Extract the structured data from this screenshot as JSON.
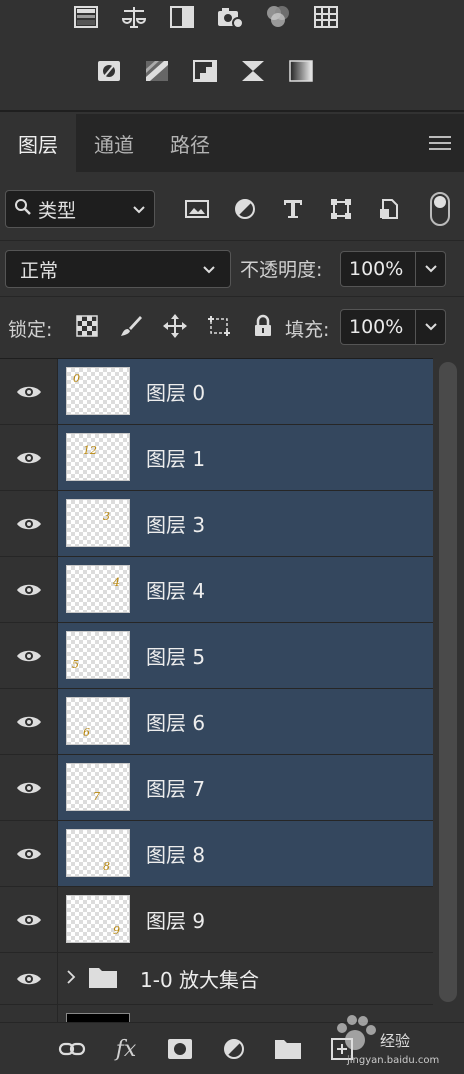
{
  "tabs": [
    {
      "label": "图层",
      "active": true
    },
    {
      "label": "通道",
      "active": false
    },
    {
      "label": "路径",
      "active": false
    }
  ],
  "filter": {
    "kind_label": "类型"
  },
  "blend": {
    "mode": "正常",
    "opacity_label": "不透明度:",
    "opacity": "100%"
  },
  "lock": {
    "label": "锁定:",
    "fill_label": "填充:",
    "fill": "100%"
  },
  "layers": [
    {
      "name": "图层 0",
      "digit": "0",
      "selected": true
    },
    {
      "name": "图层 1",
      "digit": "12",
      "selected": true
    },
    {
      "name": "图层 3",
      "digit": "3",
      "selected": true
    },
    {
      "name": "图层 4",
      "digit": "4",
      "selected": true
    },
    {
      "name": "图层 5",
      "digit": "5",
      "selected": true
    },
    {
      "name": "图层 6",
      "digit": "6",
      "selected": true
    },
    {
      "name": "图层 7",
      "digit": "7",
      "selected": true
    },
    {
      "name": "图层 8",
      "digit": "8",
      "selected": true
    },
    {
      "name": "图层 9",
      "digit": "9",
      "selected": false
    }
  ],
  "group": {
    "name": "1-0 放大集合"
  },
  "watermark": {
    "text": "经验",
    "sub": "jingyan.baidu.com"
  },
  "colors": {
    "panel": "#323232",
    "selected": "#34475e",
    "dark": "#1e1e1e"
  }
}
